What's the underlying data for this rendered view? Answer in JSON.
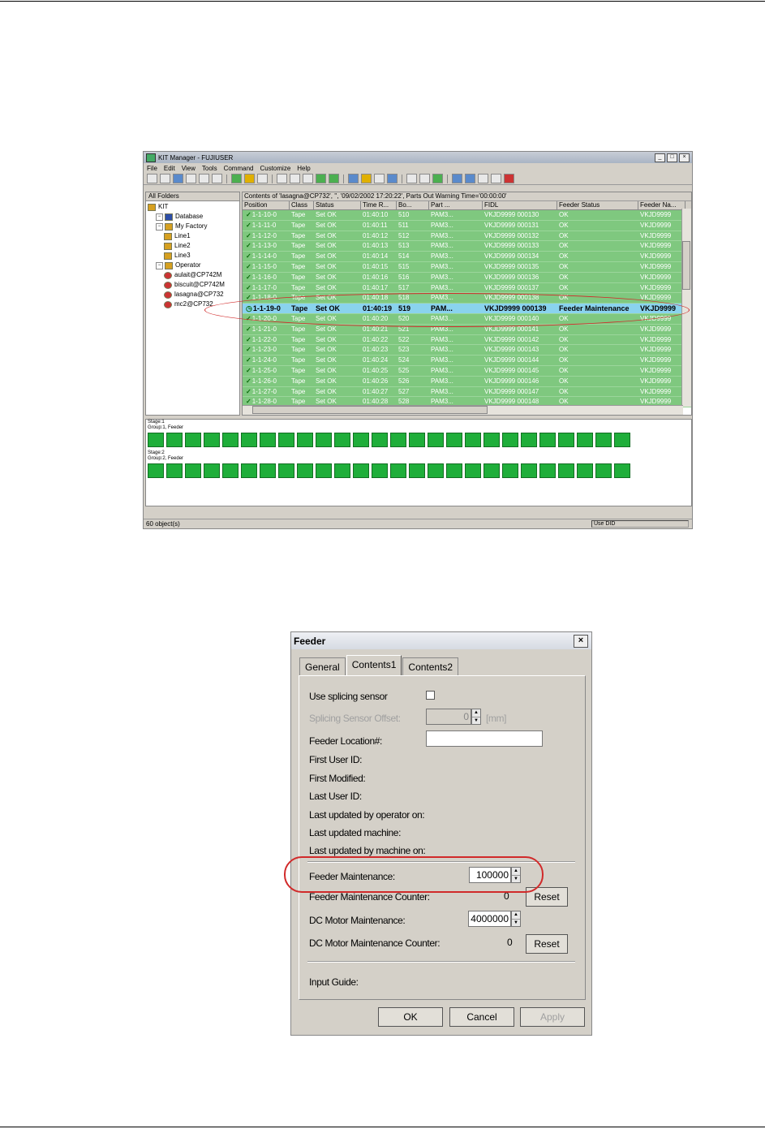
{
  "kit": {
    "title": "KIT Manager - FUJIUSER",
    "menu": [
      "File",
      "Edit",
      "View",
      "Tools",
      "Command",
      "Customize",
      "Help"
    ],
    "folders_header": "All Folders",
    "tree": [
      {
        "label": "KIT",
        "icon": "kit-icon",
        "indent": 0
      },
      {
        "label": "Database",
        "icon": "database-icon",
        "indent": 1
      },
      {
        "label": "My Factory",
        "icon": "factory-icon",
        "indent": 1
      },
      {
        "label": "Line1",
        "icon": "line-icon",
        "indent": 2
      },
      {
        "label": "Line2",
        "icon": "line-icon",
        "indent": 2
      },
      {
        "label": "Line3",
        "icon": "line-icon",
        "indent": 2
      },
      {
        "label": "Operator",
        "icon": "operator-folder-icon",
        "indent": 1
      },
      {
        "label": "aulait@CP742M",
        "icon": "operator-icon",
        "indent": 2
      },
      {
        "label": "biscuit@CP742M",
        "icon": "operator-icon",
        "indent": 2
      },
      {
        "label": "lasagna@CP732",
        "icon": "operator-icon",
        "indent": 2
      },
      {
        "label": "mc2@CP732",
        "icon": "operator-icon",
        "indent": 2
      }
    ],
    "grid_caption": "Contents of 'lasagna@CP732', '', '09/02/2002 17:20:22', Parts Out Warning Time='00:00:00'",
    "columns": [
      "Position",
      "Class",
      "Status",
      "Time R...",
      "Bo...",
      "Part ...",
      "FIDL",
      "Feeder Status",
      "Feeder Na..."
    ],
    "rows": [
      [
        "1-1-10-0",
        "Tape",
        "Set OK",
        "01:40:10",
        "510",
        "PAM3...",
        "VKJD9999 000130",
        "OK",
        "VKJD9999"
      ],
      [
        "1-1-11-0",
        "Tape",
        "Set OK",
        "01:40:11",
        "511",
        "PAM3...",
        "VKJD9999 000131",
        "OK",
        "VKJD9999"
      ],
      [
        "1-1-12-0",
        "Tape",
        "Set OK",
        "01:40:12",
        "512",
        "PAM3...",
        "VKJD9999 000132",
        "OK",
        "VKJD9999"
      ],
      [
        "1-1-13-0",
        "Tape",
        "Set OK",
        "01:40:13",
        "513",
        "PAM3...",
        "VKJD9999 000133",
        "OK",
        "VKJD9999"
      ],
      [
        "1-1-14-0",
        "Tape",
        "Set OK",
        "01:40:14",
        "514",
        "PAM3...",
        "VKJD9999 000134",
        "OK",
        "VKJD9999"
      ],
      [
        "1-1-15-0",
        "Tape",
        "Set OK",
        "01:40:15",
        "515",
        "PAM3...",
        "VKJD9999 000135",
        "OK",
        "VKJD9999"
      ],
      [
        "1-1-16-0",
        "Tape",
        "Set OK",
        "01:40:16",
        "516",
        "PAM3...",
        "VKJD9999 000136",
        "OK",
        "VKJD9999"
      ],
      [
        "1-1-17-0",
        "Tape",
        "Set OK",
        "01:40:17",
        "517",
        "PAM3...",
        "VKJD9999 000137",
        "OK",
        "VKJD9999"
      ],
      [
        "1-1-18-0",
        "Tape",
        "Set OK",
        "01:40:18",
        "518",
        "PAM3...",
        "VKJD9999 000138",
        "OK",
        "VKJD9999"
      ],
      [
        "1-1-19-0",
        "Tape",
        "Set OK",
        "01:40:19",
        "519",
        "PAM...",
        "VKJD9999 000139",
        "Feeder Maintenance",
        "VKJD9999"
      ],
      [
        "1-1-20-0",
        "Tape",
        "Set OK",
        "01:40:20",
        "520",
        "PAM3...",
        "VKJD9999 000140",
        "OK",
        "VKJD9999"
      ],
      [
        "1-1-21-0",
        "Tape",
        "Set OK",
        "01:40:21",
        "521",
        "PAM3...",
        "VKJD9999 000141",
        "OK",
        "VKJD9999"
      ],
      [
        "1-1-22-0",
        "Tape",
        "Set OK",
        "01:40:22",
        "522",
        "PAM3...",
        "VKJD9999 000142",
        "OK",
        "VKJD9999"
      ],
      [
        "1-1-23-0",
        "Tape",
        "Set OK",
        "01:40:23",
        "523",
        "PAM3...",
        "VKJD9999 000143",
        "OK",
        "VKJD9999"
      ],
      [
        "1-1-24-0",
        "Tape",
        "Set OK",
        "01:40:24",
        "524",
        "PAM3...",
        "VKJD9999 000144",
        "OK",
        "VKJD9999"
      ],
      [
        "1-1-25-0",
        "Tape",
        "Set OK",
        "01:40:25",
        "525",
        "PAM3...",
        "VKJD9999 000145",
        "OK",
        "VKJD9999"
      ],
      [
        "1-1-26-0",
        "Tape",
        "Set OK",
        "01:40:26",
        "526",
        "PAM3...",
        "VKJD9999 000146",
        "OK",
        "VKJD9999"
      ],
      [
        "1-1-27-0",
        "Tape",
        "Set OK",
        "01:40:27",
        "527",
        "PAM3...",
        "VKJD9999 000147",
        "OK",
        "VKJD9999"
      ],
      [
        "1-1-28-0",
        "Tape",
        "Set OK",
        "01:40:28",
        "528",
        "PAM3...",
        "VKJD9999 000148",
        "OK",
        "VKJD9999"
      ]
    ],
    "selected_row": 9,
    "stage1_label": "Stage:1",
    "stage1_group": "Group:1, Feeder",
    "stage2_label": "Stage:2",
    "stage2_group": "Group:2, Feeder",
    "stage1_feeders": 26,
    "stage2_feeders": 26,
    "status_left": "60 object(s)",
    "status_right": "Use DID",
    "colors": {
      "row_ok": "#7fc87f",
      "row_selected": "#8ad3ee",
      "feeder": "#1fae3a",
      "highlight": "#d12a2a"
    }
  },
  "dialog": {
    "title": "Feeder",
    "tabs": [
      "General",
      "Contents1",
      "Contents2"
    ],
    "active_tab": "Contents1",
    "use_splicing_sensor": "Use splicing sensor",
    "splicing_offset_label": "Splicing Sensor Offset:",
    "splicing_offset_value": "0",
    "splicing_offset_unit": "[mm]",
    "feeder_location_label": "Feeder Location#:",
    "feeder_location_value": "",
    "first_user_id": "First User ID:",
    "first_modified": "First Modified:",
    "last_user_id": "Last User ID:",
    "last_updated_operator": "Last updated by operator on:",
    "last_updated_machine": "Last updated machine:",
    "last_updated_by_machine": "Last updated by machine on:",
    "feeder_maintenance_label": "Feeder Maintenance:",
    "feeder_maintenance_value": "100000",
    "feeder_maintenance_counter_label": "Feeder Maintenance Counter:",
    "feeder_maintenance_counter_value": "0",
    "dc_motor_label": "DC Motor Maintenance:",
    "dc_motor_value": "4000000",
    "dc_motor_counter_label": "DC Motor Maintenance Counter:",
    "dc_motor_counter_value": "0",
    "reset_label": "Reset",
    "input_guide": "Input Guide:",
    "ok": "OK",
    "cancel": "Cancel",
    "apply": "Apply"
  }
}
